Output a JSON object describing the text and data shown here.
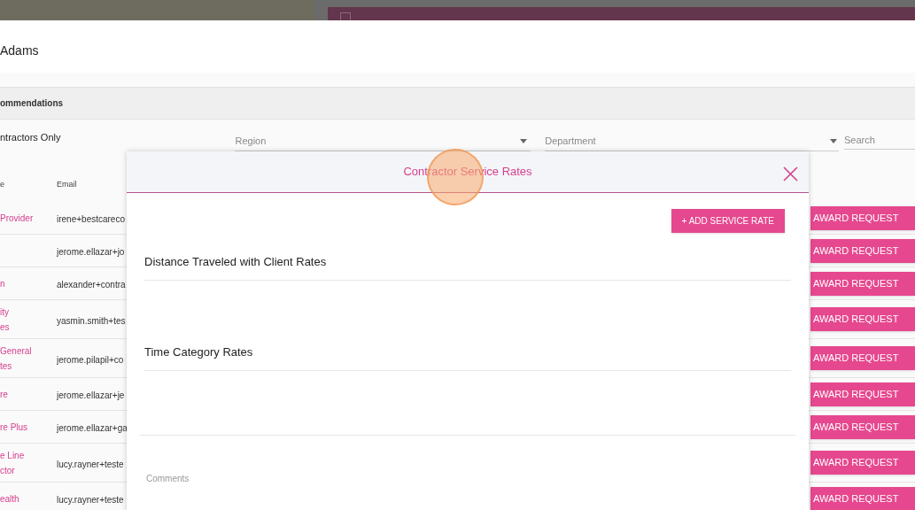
{
  "header": {
    "title": "Adams"
  },
  "section": {
    "title": "ommendations"
  },
  "filters": {
    "toggle_label": "ntractors Only",
    "region": {
      "placeholder": "Region"
    },
    "department": {
      "placeholder": "Department"
    },
    "search": {
      "placeholder": "Search"
    }
  },
  "table": {
    "columns": [
      "e",
      "Email"
    ],
    "rows": [
      {
        "name": [
          "Provider"
        ],
        "email": "irene+bestcareco",
        "action": "AWARD REQUEST"
      },
      {
        "email": "jerome.ellazar+jo",
        "action": "AWARD REQUEST"
      },
      {
        "name": [
          "n"
        ],
        "email": "alexander+contra",
        "action": "AWARD REQUEST"
      },
      {
        "name": [
          "ity",
          "es"
        ],
        "email": "yasmin.smith+tes",
        "action": "AWARD REQUEST"
      },
      {
        "name": [
          "General",
          "tes"
        ],
        "email": "jerome.pilapil+co",
        "action": "AWARD REQUEST"
      },
      {
        "name": [
          "re"
        ],
        "email": "jerome.ellazar+je",
        "action": "AWARD REQUEST"
      },
      {
        "name": [
          "re Plus"
        ],
        "email": "jerome.ellazar+ga",
        "action": "AWARD REQUEST"
      },
      {
        "name": [
          "e Line",
          "ctor"
        ],
        "email": "lucy.rayner+teste",
        "action": "AWARD REQUEST"
      },
      {
        "name": [
          "ealth"
        ],
        "email": "lucy.rayner+teste",
        "action": "AWARD REQUEST"
      }
    ]
  },
  "modal": {
    "title": "Contractor Service Rates",
    "add_button": "+ ADD SERVICE RATE",
    "sections": [
      {
        "title": "Distance Traveled with Client Rates"
      },
      {
        "title": "Time Category Rates"
      }
    ],
    "comments": {
      "placeholder": "Comments"
    }
  }
}
